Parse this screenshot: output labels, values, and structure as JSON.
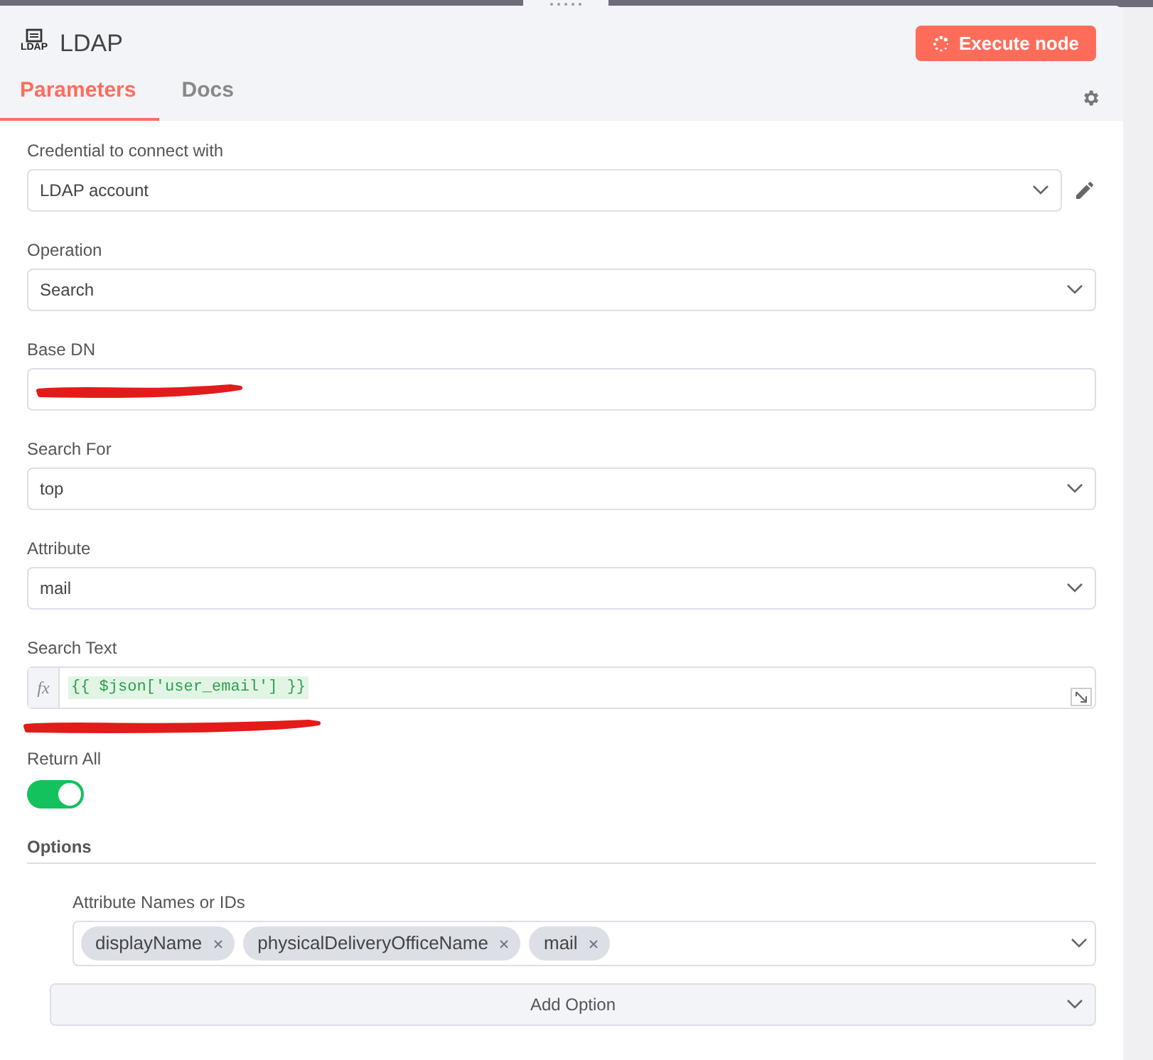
{
  "node": {
    "title": "LDAP",
    "icon_text": "LDAP"
  },
  "execute_button": {
    "label": "Execute node",
    "loading": true
  },
  "tabs": [
    {
      "label": "Parameters",
      "selected": true
    },
    {
      "label": "Docs",
      "selected": false
    }
  ],
  "parameters": [
    {
      "kind": "select",
      "label": "Credential to connect with",
      "value": "LDAP account",
      "editable": true
    },
    {
      "kind": "select",
      "label": "Operation",
      "value": "Search"
    },
    {
      "kind": "redacted",
      "label": "Base DN"
    },
    {
      "kind": "select",
      "label": "Search For",
      "value": "top"
    },
    {
      "kind": "select",
      "label": "Attribute",
      "value": "mail"
    },
    {
      "kind": "expression",
      "label": "Search Text",
      "prefix": "fx",
      "value": "{{ $json['user_email'] }}",
      "hint_redacted": true
    },
    {
      "kind": "toggle",
      "label": "Return All",
      "on": true
    }
  ],
  "options": {
    "title": "Options",
    "items": [
      {
        "label": "Attribute Names or IDs",
        "chips": [
          "displayName",
          "physicalDeliveryOfficeName",
          "mail"
        ]
      }
    ],
    "add_button": "Add Option"
  }
}
